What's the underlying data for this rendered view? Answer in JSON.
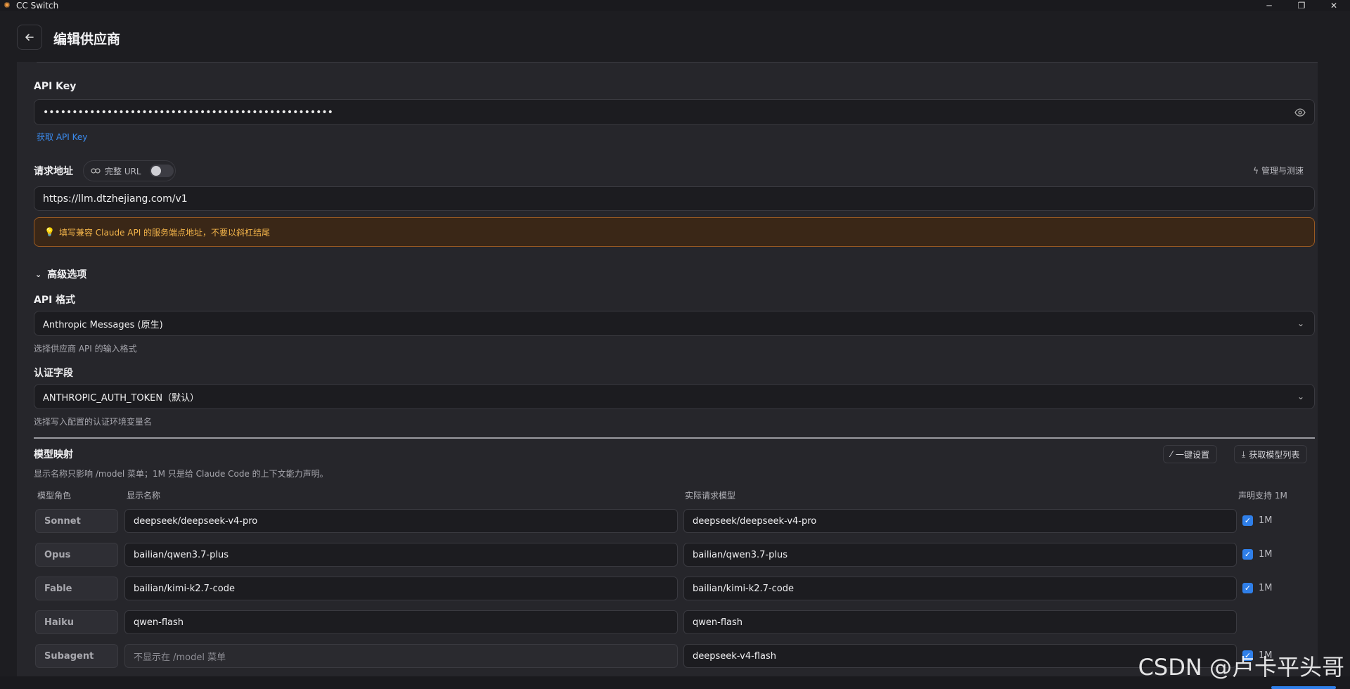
{
  "window": {
    "title": "CC Switch",
    "icons": {
      "app": "app-logo-icon",
      "min": "minimize-icon",
      "max": "restore-icon",
      "close": "close-icon"
    }
  },
  "header": {
    "title": "编辑供应商",
    "back_icon": "arrow-left-icon"
  },
  "api_key": {
    "label": "API Key",
    "value": "••••••••••••••••••••••••••••••••••••••••••••••••••",
    "eye_icon": "eye-icon",
    "get_link": "获取 API Key"
  },
  "endpoint": {
    "label": "请求地址",
    "full_url_label": "完整 URL",
    "full_url_enabled": false,
    "manage_label": "管理与测速",
    "value": "https://llm.dtzhejiang.com/v1",
    "warning": "填写兼容 Claude API 的服务端点地址，不要以斜杠结尾",
    "warning_icon": "bulb-icon"
  },
  "advanced": {
    "toggle_label": "高级选项",
    "api_format": {
      "label": "API 格式",
      "value": "Anthropic Messages (原生)",
      "hint": "选择供应商 API 的输入格式"
    },
    "auth_field": {
      "label": "认证字段",
      "value": "ANTHROPIC_AUTH_TOKEN（默认）",
      "hint": "选择写入配置的认证环境变量名"
    }
  },
  "model_mapping": {
    "title": "模型映射",
    "description": "显示名称只影响 /model 菜单；1M 只是给 Claude Code 的上下文能力声明。",
    "quick_setup": "一键设置",
    "fetch_models": "获取模型列表",
    "columns": {
      "role": "模型角色",
      "display": "显示名称",
      "actual": "实际请求模型",
      "support_1m": "声明支持 1M"
    },
    "rows": [
      {
        "role": "Sonnet",
        "display": "deepseek/deepseek-v4-pro",
        "actual": "deepseek/deepseek-v4-pro",
        "has_1m": true,
        "label_1m": "1M"
      },
      {
        "role": "Opus",
        "display": "bailian/qwen3.7-plus",
        "actual": "bailian/qwen3.7-plus",
        "has_1m": true,
        "label_1m": "1M"
      },
      {
        "role": "Fable",
        "display": "bailian/kimi-k2.7-code",
        "actual": "bailian/kimi-k2.7-code",
        "has_1m": true,
        "label_1m": "1M"
      },
      {
        "role": "Haiku",
        "display": "qwen-flash",
        "actual": "qwen-flash",
        "has_1m": false,
        "label_1m": ""
      },
      {
        "role": "Subagent",
        "display": "",
        "display_placeholder": "不显示在 /model 菜单",
        "actual": "deepseek-v4-flash",
        "has_1m": true,
        "label_1m": "1M"
      }
    ]
  },
  "watermark": "CSDN @卢卡平头哥",
  "colors": {
    "accent": "#2f7fe9",
    "warning": "#f3b44a",
    "link": "#3b8cf0"
  }
}
